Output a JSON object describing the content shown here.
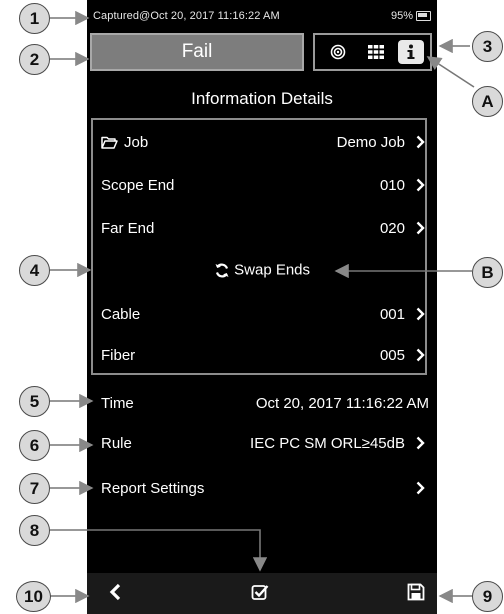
{
  "status_bar": {
    "captured": "Captured@Oct 20, 2017 11:16:22 AM",
    "battery": "95%"
  },
  "result_button": {
    "label": "Fail"
  },
  "view_buttons": [
    {
      "icon": "target-icon",
      "active": false
    },
    {
      "icon": "grid-icon",
      "active": false
    },
    {
      "icon": "info-icon",
      "active": true
    }
  ],
  "header": {
    "title": "Information Details"
  },
  "details": {
    "job": {
      "label": "Job",
      "value": "Demo Job"
    },
    "scope_end": {
      "label": "Scope End",
      "value": "010"
    },
    "far_end": {
      "label": "Far End",
      "value": "020"
    },
    "swap_ends": {
      "label": "Swap Ends"
    },
    "cable": {
      "label": "Cable",
      "value": "001"
    },
    "fiber": {
      "label": "Fiber",
      "value": "005"
    }
  },
  "time": {
    "label": "Time",
    "value": "Oct 20, 2017 11:16:22 AM"
  },
  "rule": {
    "label": "Rule",
    "value": "IEC PC SM ORL≥45dB"
  },
  "report_settings": {
    "label": "Report Settings"
  },
  "callouts": [
    "1",
    "2",
    "3",
    "A",
    "4",
    "B",
    "5",
    "6",
    "7",
    "8",
    "9",
    "10"
  ],
  "colors": {
    "fail_bg": "#7d7d7d",
    "screen_bg": "#000000",
    "footer_bg": "#1a1a1a",
    "callout_bg": "#d9d9d9"
  }
}
